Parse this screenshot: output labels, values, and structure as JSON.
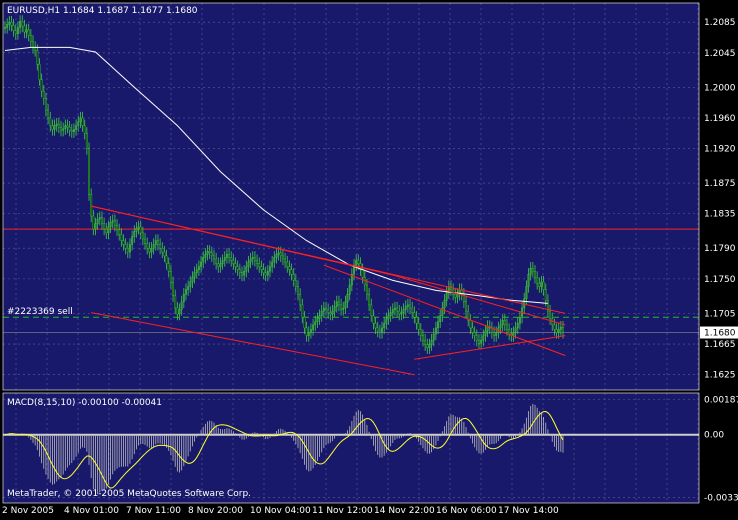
{
  "chart_data": [
    {
      "type": "candlestick",
      "title": "EURUSD,H1  1.1684 1.1687 1.1677 1.1680",
      "symbol": "EURUSD",
      "timeframe": "H1",
      "ohlc_readout": "1.1684 1.1687 1.1677 1.1680",
      "ylim": [
        1.1605,
        1.211
      ],
      "price_ticks": [
        "1.2085",
        "1.2045",
        "1.2000",
        "1.1960",
        "1.1920",
        "1.1875",
        "1.1835",
        "1.1790",
        "1.1750",
        "1.1705",
        "1.1665",
        "1.1625"
      ],
      "current_price": "1.1680",
      "time_labels": [
        "2 Nov 2005",
        "4 Nov 01:00",
        "7 Nov 11:00",
        "8 Nov 20:00",
        "10 Nov 04:00",
        "11 Nov 12:00",
        "14 Nov 22:00",
        "16 Nov 06:00",
        "17 Nov 14:00"
      ],
      "order_label": "#2223369 sell",
      "order_price": 1.17,
      "horizontal_line_price": 1.1815,
      "close_series": [
        1.2078,
        1.2082,
        1.2085,
        1.2081,
        1.2074,
        1.207,
        1.2078,
        1.2086,
        1.208,
        1.2072,
        1.2075,
        1.2068,
        1.206,
        1.2052,
        1.2048,
        1.203,
        1.201,
        1.1995,
        1.1985,
        1.197,
        1.196,
        1.195,
        1.1945,
        1.195,
        1.1952,
        1.1948,
        1.1944,
        1.1946,
        1.195,
        1.1948,
        1.1944,
        1.1942,
        1.1945,
        1.195,
        1.1955,
        1.196,
        1.195,
        1.194,
        1.192,
        1.186,
        1.1832,
        1.1815,
        1.1822,
        1.1828,
        1.183,
        1.1822,
        1.1815,
        1.181,
        1.1818,
        1.1824,
        1.1826,
        1.182,
        1.1814,
        1.1808,
        1.18,
        1.1795,
        1.179,
        1.1785,
        1.1795,
        1.1805,
        1.1812,
        1.1816,
        1.1818,
        1.181,
        1.1802,
        1.1796,
        1.179,
        1.1785,
        1.179,
        1.1795,
        1.18,
        1.1795,
        1.179,
        1.1785,
        1.178,
        1.177,
        1.176,
        1.1745,
        1.1728,
        1.1712,
        1.1704,
        1.171,
        1.172,
        1.173,
        1.1736,
        1.174,
        1.1746,
        1.1752,
        1.1758,
        1.1762,
        1.1766,
        1.1772,
        1.1778,
        1.1782,
        1.1786,
        1.1784,
        1.178,
        1.1776,
        1.177,
        1.1766,
        1.177,
        1.1774,
        1.1778,
        1.1782,
        1.1778,
        1.1774,
        1.177,
        1.1766,
        1.1762,
        1.1758,
        1.1755,
        1.176,
        1.1766,
        1.1772,
        1.1776,
        1.1778,
        1.1774,
        1.177,
        1.1766,
        1.1762,
        1.1758,
        1.1755,
        1.176,
        1.1766,
        1.1772,
        1.1778,
        1.1782,
        1.1784,
        1.178,
        1.1776,
        1.1772,
        1.1766,
        1.1762,
        1.1756,
        1.1748,
        1.174,
        1.173,
        1.1716,
        1.17,
        1.1686,
        1.1676,
        1.168,
        1.1684,
        1.169,
        1.1694,
        1.1698,
        1.1702,
        1.1708,
        1.1712,
        1.171,
        1.1706,
        1.1704,
        1.1708,
        1.1714,
        1.172,
        1.1716,
        1.171,
        1.1712,
        1.172,
        1.173,
        1.1742,
        1.1756,
        1.1768,
        1.1774,
        1.177,
        1.1762,
        1.1752,
        1.1742,
        1.173,
        1.1716,
        1.1702,
        1.1692,
        1.1686,
        1.1682,
        1.168,
        1.1686,
        1.1692,
        1.1698,
        1.1702,
        1.1706,
        1.171,
        1.1712,
        1.1708,
        1.1704,
        1.1706,
        1.171,
        1.1714,
        1.1716,
        1.1712,
        1.1706,
        1.17,
        1.1692,
        1.1684,
        1.1676,
        1.167,
        1.1664,
        1.166,
        1.1664,
        1.167,
        1.1678,
        1.1686,
        1.1694,
        1.1702,
        1.1712,
        1.1722,
        1.1732,
        1.174,
        1.1736,
        1.173,
        1.1726,
        1.173,
        1.1736,
        1.173,
        1.172,
        1.1708,
        1.1696,
        1.1686,
        1.168,
        1.1676,
        1.167,
        1.1666,
        1.167,
        1.1676,
        1.1682,
        1.1688,
        1.1686,
        1.168,
        1.1676,
        1.168,
        1.1686,
        1.169,
        1.1696,
        1.169,
        1.1684,
        1.1678,
        1.1676,
        1.168,
        1.1686,
        1.1692,
        1.17,
        1.1712,
        1.1724,
        1.174,
        1.1756,
        1.1764,
        1.176,
        1.1752,
        1.1744,
        1.174,
        1.1746,
        1.1736,
        1.1722,
        1.1708,
        1.1698,
        1.169,
        1.1684,
        1.168,
        1.1684,
        1.1687,
        1.168
      ],
      "moving_average": [
        [
          0,
          1.2048
        ],
        [
          12,
          1.2052
        ],
        [
          30,
          1.2052
        ],
        [
          42,
          1.2046
        ],
        [
          60,
          1.2
        ],
        [
          80,
          1.195
        ],
        [
          100,
          1.189
        ],
        [
          120,
          1.184
        ],
        [
          140,
          1.18
        ],
        [
          160,
          1.1768
        ],
        [
          180,
          1.1748
        ],
        [
          200,
          1.1735
        ],
        [
          220,
          1.1728
        ],
        [
          235,
          1.1722
        ],
        [
          252,
          1.1718
        ]
      ],
      "trendlines": [
        {
          "color": "#ff2020",
          "points": [
            [
              40,
              1.1845
            ],
            [
              180,
              1.1755
            ],
            [
              260,
              1.169
            ]
          ]
        },
        {
          "color": "#ff2020",
          "points": [
            [
              40,
              1.1845
            ],
            [
              260,
              1.1705
            ]
          ]
        },
        {
          "color": "#ff2020",
          "points": [
            [
              40,
              1.1706
            ],
            [
              190,
              1.1625
            ]
          ]
        },
        {
          "color": "#ff2020",
          "points": [
            [
              148,
              1.1768
            ],
            [
              260,
              1.165
            ]
          ]
        },
        {
          "color": "#ff2020",
          "points": [
            [
              190,
              1.1645
            ],
            [
              260,
              1.1676
            ]
          ]
        }
      ],
      "grid": true,
      "colors": {
        "background": "#000000",
        "plot_area": "#19196b",
        "grid": "#5d5da0",
        "candle": "#2f9a2f",
        "candle_border": "#3fcf3f",
        "moving_average": "#ffffff",
        "trendline": "#ff2020",
        "order_line": "#1fbf1f",
        "axis_text": "#ffffff"
      }
    },
    {
      "type": "bar",
      "title": "MACD(8,15,10) -0.00100 -0.00041",
      "indicator": "MACD(8,15,10)",
      "main_value": "-0.00100",
      "signal_value": "-0.00041",
      "ylim": [
        -0.0036,
        0.0022
      ],
      "ticks": [
        "0.00187",
        "0.00",
        "-0.00330"
      ],
      "grid": true,
      "colors": {
        "histogram": "#bdbdbd",
        "signal": "#ffff33",
        "zero_line": "#cfcfcf"
      }
    }
  ],
  "copyright": "MetaTrader, © 2001-2005 MetaQuotes Software Corp."
}
